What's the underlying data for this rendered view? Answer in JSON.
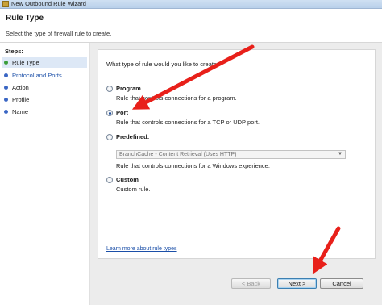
{
  "window": {
    "title": "New Outbound Rule Wizard"
  },
  "header": {
    "title": "Rule Type",
    "subtitle": "Select the type of firewall rule to create."
  },
  "steps": {
    "title": "Steps:",
    "items": [
      {
        "label": "Rule Type",
        "current": true
      },
      {
        "label": "Protocol and Ports",
        "current": false
      },
      {
        "label": "Action",
        "current": false
      },
      {
        "label": "Profile",
        "current": false
      },
      {
        "label": "Name",
        "current": false
      }
    ]
  },
  "main": {
    "question": "What type of rule would you like to create?",
    "options": {
      "program": {
        "label": "Program",
        "desc": "Rule that controls connections for a program.",
        "selected": false
      },
      "port": {
        "label": "Port",
        "desc": "Rule that controls connections for a TCP or UDP port.",
        "selected": true
      },
      "predefined": {
        "label": "Predefined:",
        "select_value": "BranchCache - Content Retrieval (Uses HTTP)",
        "desc": "Rule that controls connections for a Windows experience.",
        "selected": false
      },
      "custom": {
        "label": "Custom",
        "desc": "Custom rule.",
        "selected": false
      }
    },
    "learn_more": "Learn more about rule types"
  },
  "buttons": {
    "back": "< Back",
    "next": "Next >",
    "cancel": "Cancel"
  },
  "colors": {
    "annotation_arrow": "#e8201a",
    "link": "#1b4fa8",
    "accent": "#3a66c4"
  }
}
